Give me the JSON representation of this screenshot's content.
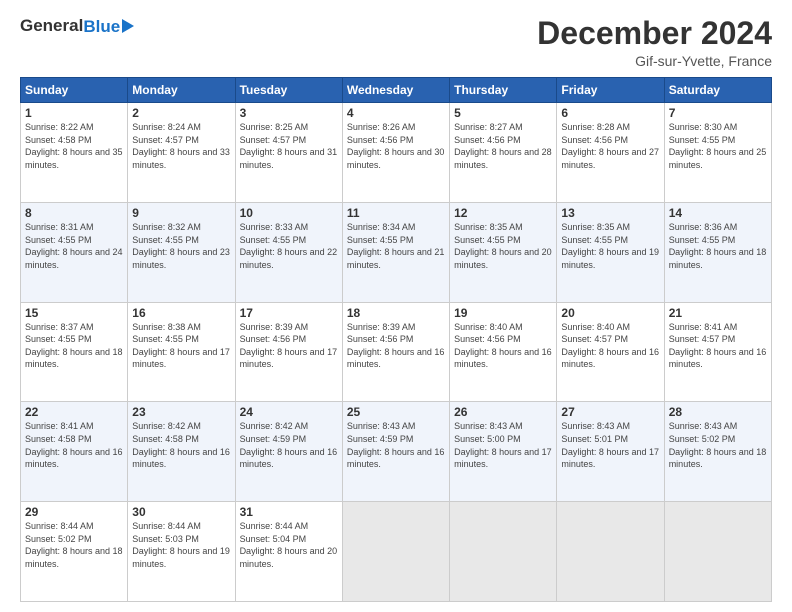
{
  "header": {
    "logo_general": "General",
    "logo_blue": "Blue",
    "month_title": "December 2024",
    "location": "Gif-sur-Yvette, France"
  },
  "weekdays": [
    "Sunday",
    "Monday",
    "Tuesday",
    "Wednesday",
    "Thursday",
    "Friday",
    "Saturday"
  ],
  "weeks": [
    [
      {
        "day": "1",
        "sunrise": "8:22 AM",
        "sunset": "4:58 PM",
        "daylight": "8 hours and 35 minutes."
      },
      {
        "day": "2",
        "sunrise": "8:24 AM",
        "sunset": "4:57 PM",
        "daylight": "8 hours and 33 minutes."
      },
      {
        "day": "3",
        "sunrise": "8:25 AM",
        "sunset": "4:57 PM",
        "daylight": "8 hours and 31 minutes."
      },
      {
        "day": "4",
        "sunrise": "8:26 AM",
        "sunset": "4:56 PM",
        "daylight": "8 hours and 30 minutes."
      },
      {
        "day": "5",
        "sunrise": "8:27 AM",
        "sunset": "4:56 PM",
        "daylight": "8 hours and 28 minutes."
      },
      {
        "day": "6",
        "sunrise": "8:28 AM",
        "sunset": "4:56 PM",
        "daylight": "8 hours and 27 minutes."
      },
      {
        "day": "7",
        "sunrise": "8:30 AM",
        "sunset": "4:55 PM",
        "daylight": "8 hours and 25 minutes."
      }
    ],
    [
      {
        "day": "8",
        "sunrise": "8:31 AM",
        "sunset": "4:55 PM",
        "daylight": "8 hours and 24 minutes."
      },
      {
        "day": "9",
        "sunrise": "8:32 AM",
        "sunset": "4:55 PM",
        "daylight": "8 hours and 23 minutes."
      },
      {
        "day": "10",
        "sunrise": "8:33 AM",
        "sunset": "4:55 PM",
        "daylight": "8 hours and 22 minutes."
      },
      {
        "day": "11",
        "sunrise": "8:34 AM",
        "sunset": "4:55 PM",
        "daylight": "8 hours and 21 minutes."
      },
      {
        "day": "12",
        "sunrise": "8:35 AM",
        "sunset": "4:55 PM",
        "daylight": "8 hours and 20 minutes."
      },
      {
        "day": "13",
        "sunrise": "8:35 AM",
        "sunset": "4:55 PM",
        "daylight": "8 hours and 19 minutes."
      },
      {
        "day": "14",
        "sunrise": "8:36 AM",
        "sunset": "4:55 PM",
        "daylight": "8 hours and 18 minutes."
      }
    ],
    [
      {
        "day": "15",
        "sunrise": "8:37 AM",
        "sunset": "4:55 PM",
        "daylight": "8 hours and 18 minutes."
      },
      {
        "day": "16",
        "sunrise": "8:38 AM",
        "sunset": "4:55 PM",
        "daylight": "8 hours and 17 minutes."
      },
      {
        "day": "17",
        "sunrise": "8:39 AM",
        "sunset": "4:56 PM",
        "daylight": "8 hours and 17 minutes."
      },
      {
        "day": "18",
        "sunrise": "8:39 AM",
        "sunset": "4:56 PM",
        "daylight": "8 hours and 16 minutes."
      },
      {
        "day": "19",
        "sunrise": "8:40 AM",
        "sunset": "4:56 PM",
        "daylight": "8 hours and 16 minutes."
      },
      {
        "day": "20",
        "sunrise": "8:40 AM",
        "sunset": "4:57 PM",
        "daylight": "8 hours and 16 minutes."
      },
      {
        "day": "21",
        "sunrise": "8:41 AM",
        "sunset": "4:57 PM",
        "daylight": "8 hours and 16 minutes."
      }
    ],
    [
      {
        "day": "22",
        "sunrise": "8:41 AM",
        "sunset": "4:58 PM",
        "daylight": "8 hours and 16 minutes."
      },
      {
        "day": "23",
        "sunrise": "8:42 AM",
        "sunset": "4:58 PM",
        "daylight": "8 hours and 16 minutes."
      },
      {
        "day": "24",
        "sunrise": "8:42 AM",
        "sunset": "4:59 PM",
        "daylight": "8 hours and 16 minutes."
      },
      {
        "day": "25",
        "sunrise": "8:43 AM",
        "sunset": "4:59 PM",
        "daylight": "8 hours and 16 minutes."
      },
      {
        "day": "26",
        "sunrise": "8:43 AM",
        "sunset": "5:00 PM",
        "daylight": "8 hours and 17 minutes."
      },
      {
        "day": "27",
        "sunrise": "8:43 AM",
        "sunset": "5:01 PM",
        "daylight": "8 hours and 17 minutes."
      },
      {
        "day": "28",
        "sunrise": "8:43 AM",
        "sunset": "5:02 PM",
        "daylight": "8 hours and 18 minutes."
      }
    ],
    [
      {
        "day": "29",
        "sunrise": "8:44 AM",
        "sunset": "5:02 PM",
        "daylight": "8 hours and 18 minutes."
      },
      {
        "day": "30",
        "sunrise": "8:44 AM",
        "sunset": "5:03 PM",
        "daylight": "8 hours and 19 minutes."
      },
      {
        "day": "31",
        "sunrise": "8:44 AM",
        "sunset": "5:04 PM",
        "daylight": "8 hours and 20 minutes."
      },
      null,
      null,
      null,
      null
    ]
  ],
  "labels": {
    "sunrise": "Sunrise:",
    "sunset": "Sunset:",
    "daylight": "Daylight:"
  }
}
